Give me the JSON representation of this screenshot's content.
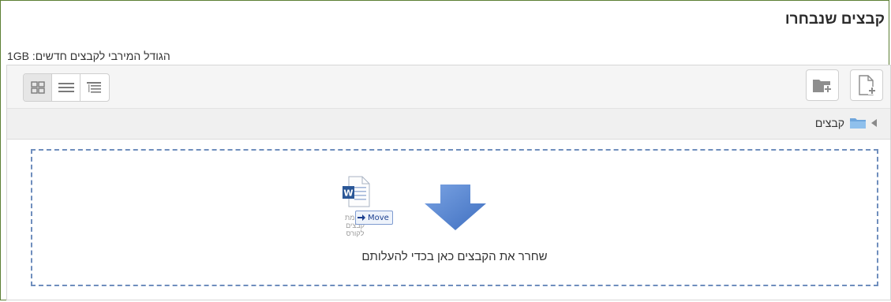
{
  "title": "קבצים שנבחרו",
  "max_size": "הגודל המירבי לקבצים חדשים: 1GB",
  "toolbar": {
    "view_buttons": [
      "icons-view",
      "list-view",
      "tree-view"
    ],
    "add_file_icon": "add-file-icon",
    "create_folder_icon": "create-folder-icon"
  },
  "path": {
    "label": "קבצים"
  },
  "dropzone": {
    "text": "שחרר את הקבצים כאן בכדי להעלותם",
    "drag_tooltip": "Move",
    "ghost_label": "רשימת קבצים לקורס"
  },
  "colors": {
    "frame_border": "#5c7f34",
    "dropzone_border": "#6f8ebd",
    "arrow_blue": "#4d7fcf"
  }
}
